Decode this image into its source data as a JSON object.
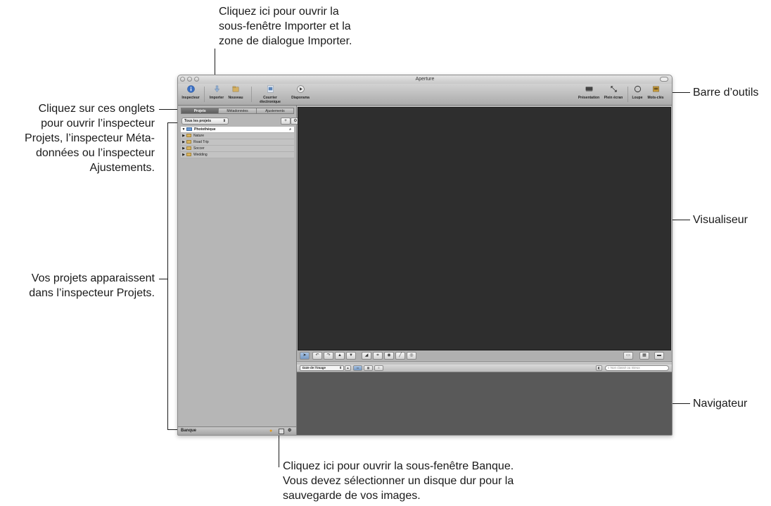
{
  "callouts": {
    "importer": [
      "Cliquez ici pour ouvrir la",
      "sous-fenêtre Importer et la",
      "zone de dialogue Importer."
    ],
    "toolbar": [
      "Barre d’outils"
    ],
    "tabs": [
      "Cliquez sur ces onglets",
      "pour ouvrir l’inspecteur",
      "Projets, l’inspecteur Méta-",
      "données ou l’inspecteur",
      "Ajustements."
    ],
    "viewer": [
      "Visualiseur"
    ],
    "projects": [
      "Vos projets apparaissent",
      "dans l’inspecteur Projets."
    ],
    "browser": [
      "Navigateur"
    ],
    "vault": [
      "Cliquez ici pour ouvrir la sous-fenêtre Banque.",
      "Vous devez sélectionner un disque dur pour la",
      "sauvegarde de vos images."
    ]
  },
  "window": {
    "title": "Aperture",
    "toolbar": {
      "inspector": "Inspecteur",
      "import": "Importer",
      "new": "Nouveau",
      "email": "Courrier électronique",
      "slideshow": "Diaporama",
      "presentation": "Présentation",
      "fullscreen": "Plein écran",
      "loupe": "Loupe",
      "keywords": "Mots-clés"
    },
    "tabs": [
      "Projets",
      "Métadonnées",
      "Ajustements"
    ],
    "projects_filter": "Tous les projets",
    "library_root": "Photothèque",
    "projects": [
      "Nature",
      "Road Trip",
      "Soccer",
      "Wedding"
    ],
    "vault_label": "Banque",
    "sort_by": "Date de l’image",
    "search_placeholder": "Non classé ou mieux"
  },
  "colors": {
    "viewer_bg": "#2e2e2e",
    "browser_bg": "#595959",
    "selection": "#7699c3"
  },
  "icons": [
    "info-icon",
    "import-icon",
    "new-folder-icon",
    "email-icon",
    "play-icon",
    "monitor-icon",
    "fullscreen-icon",
    "loupe-icon",
    "keywords-icon",
    "search-icon",
    "gear-icon",
    "plus-icon",
    "vault-icon"
  ]
}
